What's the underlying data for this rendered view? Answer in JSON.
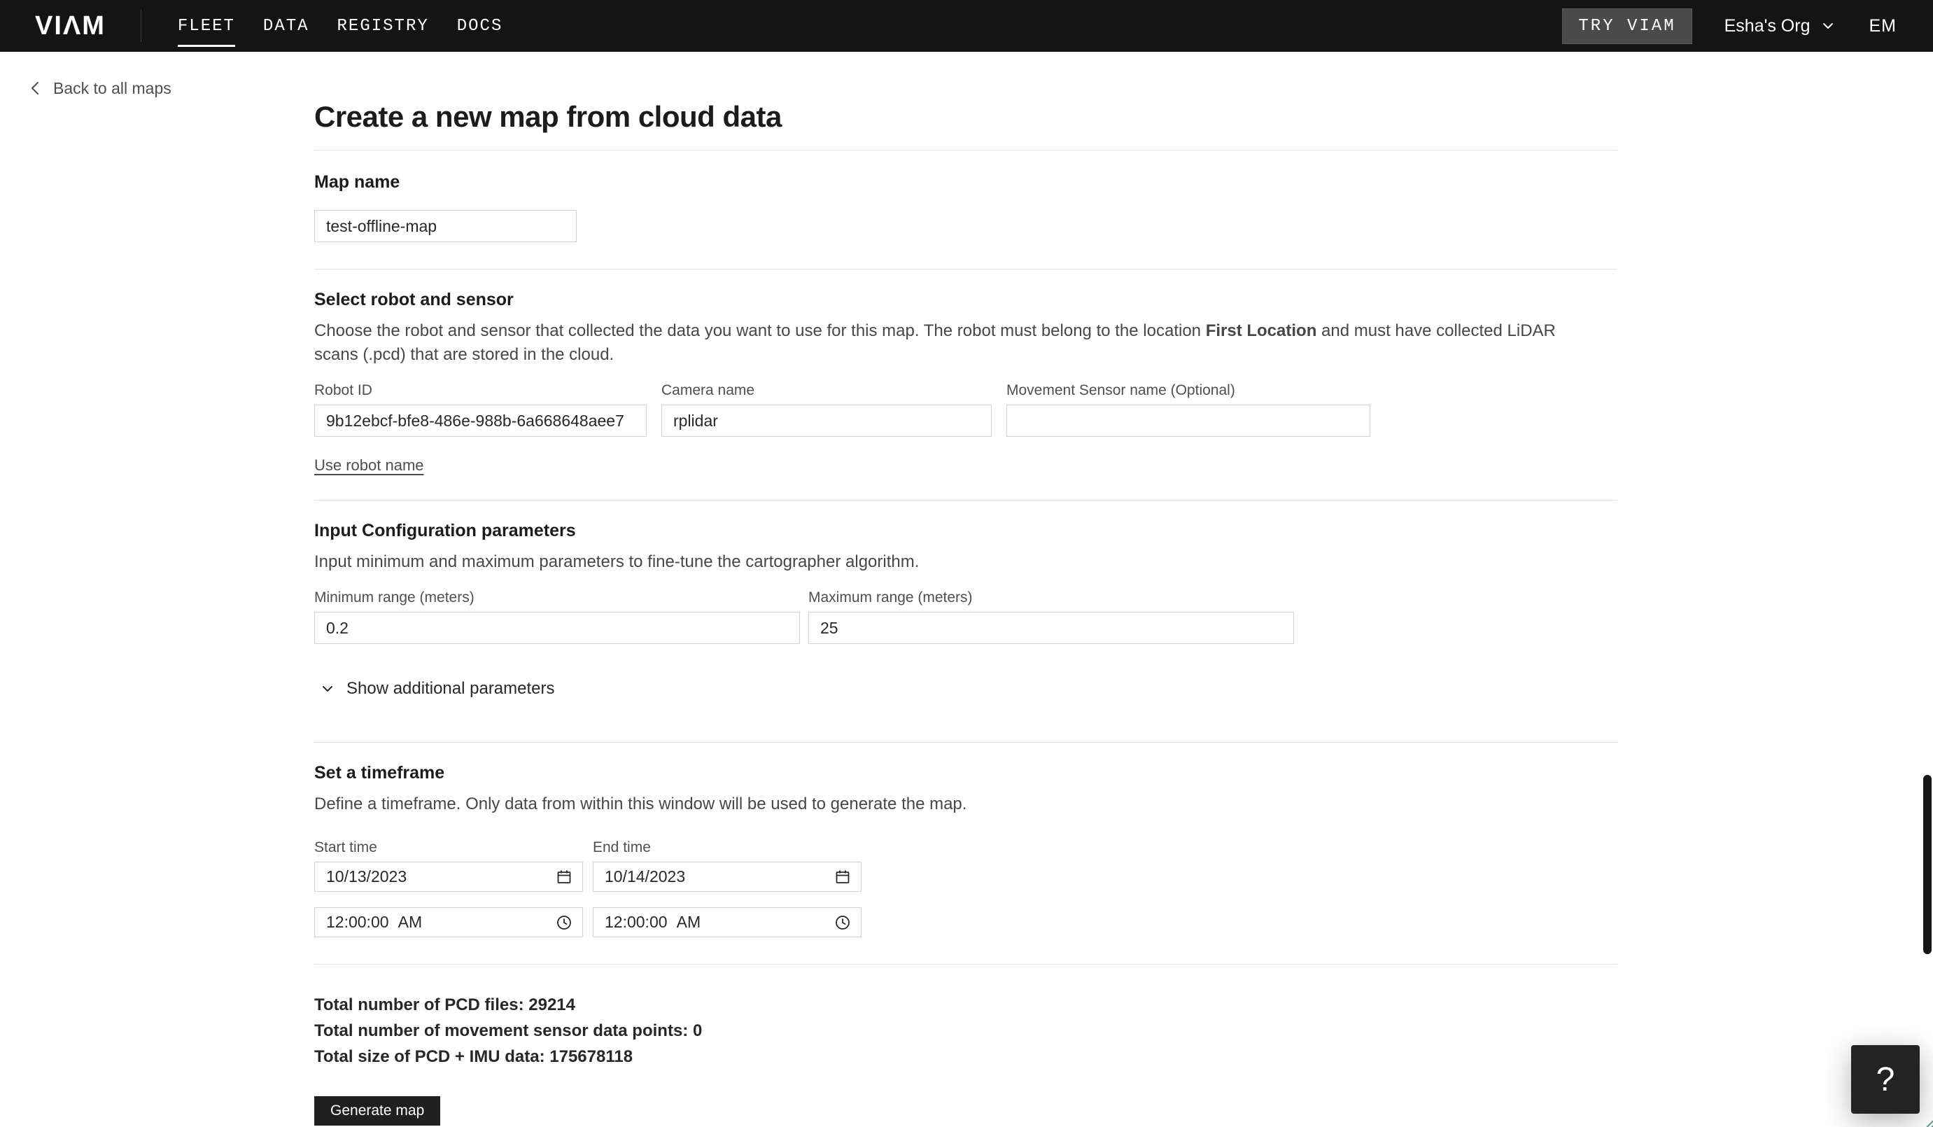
{
  "nav": {
    "brand": "VIΛM",
    "items": [
      {
        "label": "FLEET"
      },
      {
        "label": "DATA"
      },
      {
        "label": "REGISTRY"
      },
      {
        "label": "DOCS"
      }
    ],
    "try_viam_label": "TRY VIAM",
    "org_name": "Esha's Org",
    "user_initials": "EM"
  },
  "page": {
    "back_link": "Back to all maps",
    "title": "Create a new map from cloud data"
  },
  "map_name": {
    "label": "Map name",
    "value": "test-offline-map"
  },
  "robot_sensor": {
    "heading": "Select robot and sensor",
    "description_before": "Choose the robot and sensor that collected the data you want to use for this map. The robot must belong to the location ",
    "location_name": "First Location",
    "description_after": " and must have collected LiDAR scans (.pcd) that are stored in the cloud.",
    "robot_id": {
      "label": "Robot ID",
      "value": "9b12ebcf-bfe8-486e-988b-6a668648aee7"
    },
    "camera_name": {
      "label": "Camera name",
      "value": "rplidar"
    },
    "movement_sensor": {
      "label": "Movement Sensor name (Optional)",
      "value": ""
    },
    "use_robot_name_link": "Use robot name"
  },
  "config_params": {
    "heading": "Input Configuration parameters",
    "description": "Input minimum and maximum parameters to fine-tune the cartographer algorithm.",
    "min_range": {
      "label": "Minimum range (meters)",
      "value": "0.2"
    },
    "max_range": {
      "label": "Maximum range (meters)",
      "value": "25"
    },
    "show_additional_label": "Show additional parameters"
  },
  "timeframe": {
    "heading": "Set a timeframe",
    "description": "Define a timeframe. Only data from within this window will be used to generate the map.",
    "start": {
      "label": "Start time",
      "date": "10/13/2023",
      "time": "12:00:00 AM"
    },
    "end": {
      "label": "End time",
      "date": "10/14/2023",
      "time": "12:00:00 AM"
    }
  },
  "summary": {
    "pcd_files_label": "Total number of PCD files:",
    "pcd_files_value": "29214",
    "movement_points_label": "Total number of movement sensor data points:",
    "movement_points_value": "0",
    "total_size_label": "Total size of PCD + IMU data:",
    "total_size_value": "175678118"
  },
  "actions": {
    "generate_map": "Generate map",
    "help": "?"
  },
  "colors": {
    "nav_bg": "#141414",
    "accent_underline": "#ffffff",
    "try_viam_bg": "#4a4a4a",
    "button_bg": "#1f1f1f",
    "input_border": "#d4d4d4",
    "divider": "#e4e4e4",
    "text_primary": "#282828",
    "text_secondary": "#4f4f4f",
    "grip_teal": "#578a8a"
  }
}
